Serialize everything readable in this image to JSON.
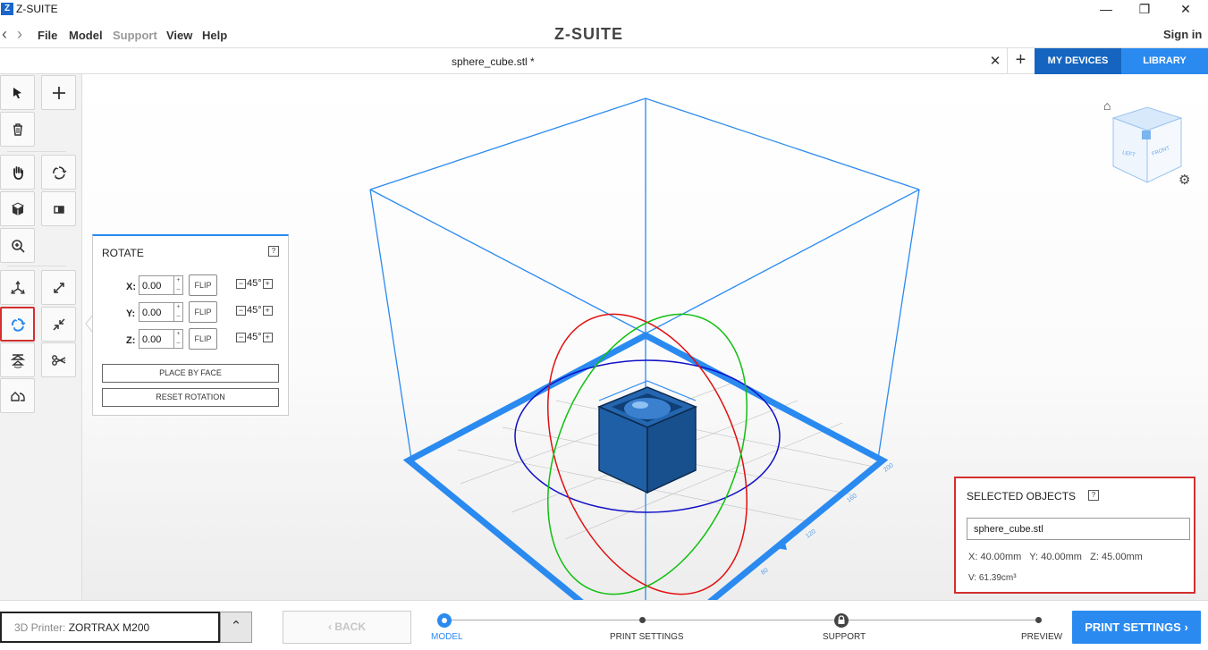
{
  "window": {
    "app_icon_letter": "Z",
    "title": "Z-SUITE",
    "minimize": "—",
    "restore": "❐",
    "close": "✕"
  },
  "menubar": {
    "back": "‹",
    "forward": "›",
    "items": [
      "File",
      "Model",
      "Support",
      "View",
      "Help"
    ],
    "logo": "Z-SUITE",
    "signin": "Sign in"
  },
  "tabs": {
    "file_name": "sphere_cube.stl *",
    "close": "✕",
    "add": "+",
    "my_devices": "MY DEVICES",
    "library": "LIBRARY"
  },
  "toolbar": {
    "icons": [
      "select-icon",
      "add-icon",
      "delete-icon",
      "pan-hand-icon",
      "orbit-icon",
      "view-cube-icon",
      "view-side-icon",
      "zoom-icon",
      "move-icon",
      "scale-icon",
      "rotate-icon",
      "fit-icon",
      "mirror-icon",
      "cut-icon",
      "place-on-bed-icon"
    ]
  },
  "rotate_panel": {
    "title": "ROTATE",
    "help": "?",
    "rows": [
      {
        "axis": "X:",
        "value": "0.00",
        "flip": "FLIP",
        "step": "45°"
      },
      {
        "axis": "Y:",
        "value": "0.00",
        "flip": "FLIP",
        "step": "45°"
      },
      {
        "axis": "Z:",
        "value": "0.00",
        "flip": "FLIP",
        "step": "45°"
      }
    ],
    "spin_up": "+",
    "spin_down": "–",
    "minus": "−",
    "plus": "+",
    "place_by_face": "PLACE BY FACE",
    "reset_rotation": "RESET ROTATION"
  },
  "view_cube": {
    "home": "⌂",
    "left_label": "LEFT",
    "front_label": "FRONT",
    "settings": "⚙"
  },
  "bed_ticks": [
    "200",
    "160",
    "120",
    "80"
  ],
  "selected_objects": {
    "title": "SELECTED OBJECTS",
    "help": "?",
    "name": "sphere_cube.stl",
    "dims": "X: 40.00mm   Y: 40.00mm   Z: 45.00mm",
    "volume": "V: 61.39cm³"
  },
  "bottombar": {
    "printer_label": "3D Printer:",
    "printer_name": "ZORTRAX M200",
    "dropdown_arrow": "⌃",
    "back": "‹  BACK",
    "steps": [
      "MODEL",
      "PRINT SETTINGS",
      "SUPPORT",
      "PREVIEW"
    ],
    "active_step": "MODEL",
    "print_settings_btn": "PRINT SETTINGS  ›"
  },
  "colors": {
    "accent": "#2a8af0",
    "accent_dark": "#1565c0",
    "highlight_red": "#d32f2f",
    "model_blue": "#1f5fa6",
    "x_ring": "#e01010",
    "y_ring": "#10c010",
    "z_ring": "#1010c8"
  }
}
